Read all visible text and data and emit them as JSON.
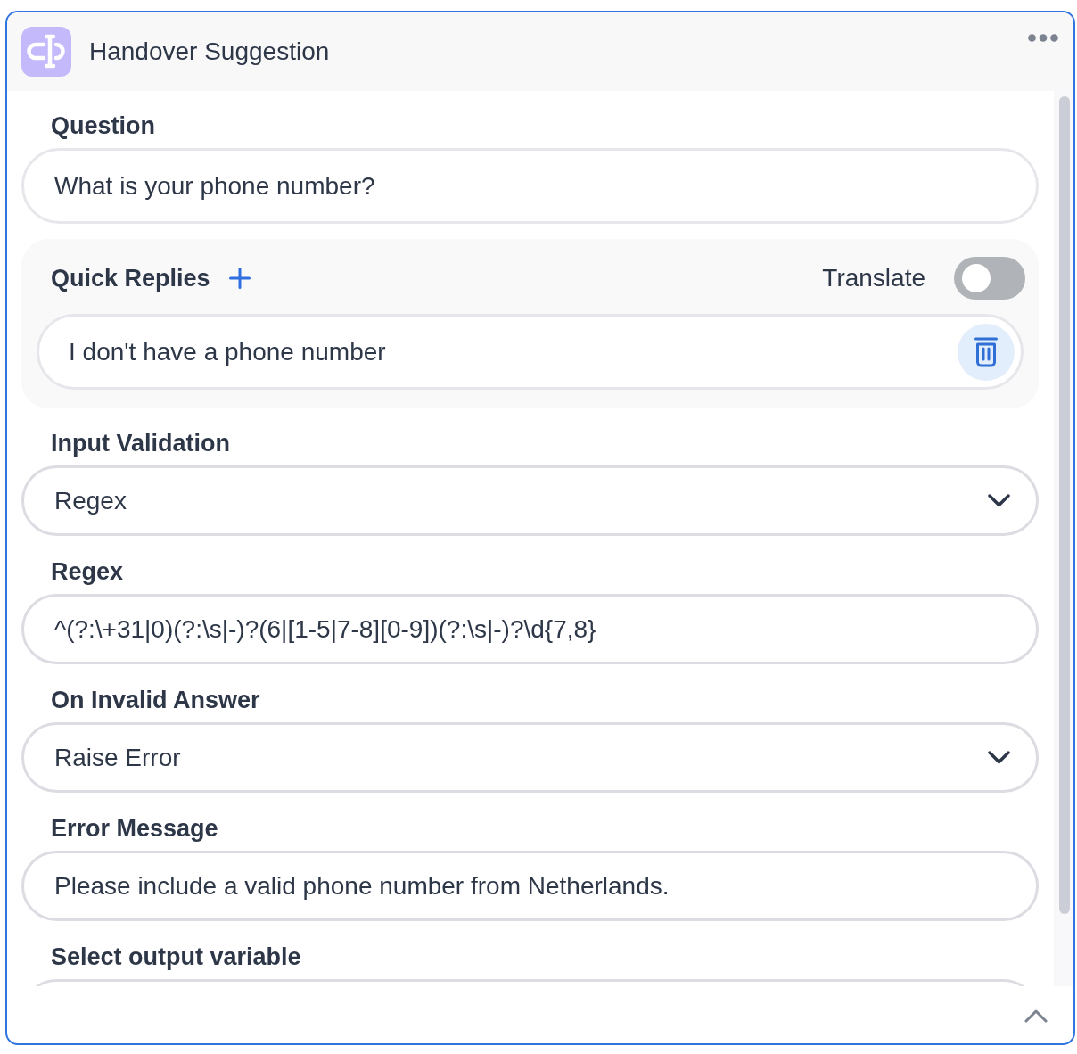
{
  "node": {
    "title": "Handover Suggestion"
  },
  "question": {
    "label": "Question",
    "kind": "text",
    "value": "What is your phone number?"
  },
  "quick_replies": {
    "label": "Quick Replies",
    "translate": {
      "label": "Translate",
      "on": false
    },
    "items": [
      {
        "value": "I don't have a phone number"
      }
    ]
  },
  "settings": [
    {
      "kind": "select",
      "label": "Input Validation",
      "value": "Regex"
    },
    {
      "kind": "text",
      "label": "Regex",
      "value": "^(?:\\+31|0)(?:\\s|-)?(6|[1-5|7-8][0-9])(?:\\s|-)?\\d{7,8}"
    },
    {
      "kind": "select",
      "label": "On Invalid Answer",
      "value": "Raise Error"
    },
    {
      "kind": "text",
      "label": "Error Message",
      "value": "Please include a valid phone number from Netherlands."
    },
    {
      "kind": "text",
      "label": "Select output variable"
    }
  ]
}
